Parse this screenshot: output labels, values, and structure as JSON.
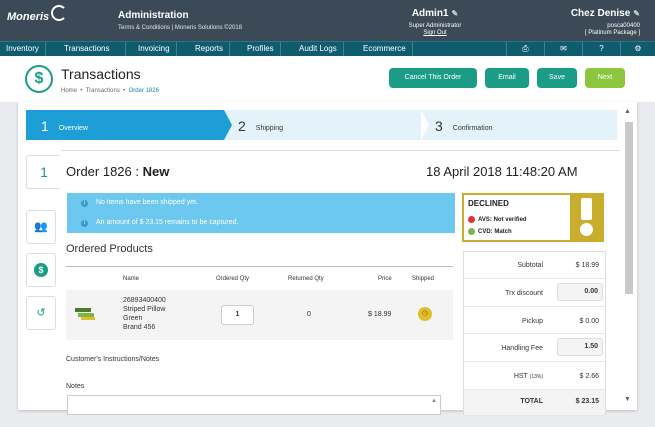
{
  "topbar": {
    "logo_text": "Moneris",
    "title": "Administration",
    "subtitle": "Terms & Conditions | Moneris Solutions ©2018",
    "user_name": "Admin1",
    "user_role": "Super Administrator",
    "sign_out": "Sign Out",
    "store_name": "Chez Denise",
    "store_id": "posca00400",
    "store_package": "[ Platinum Package ]"
  },
  "nav": {
    "items": [
      "Inventory",
      "Transactions",
      "Invoicing",
      "Reports",
      "Profiles",
      "Audit Logs",
      "Ecommerce"
    ],
    "icons": [
      "printer-icon",
      "mail-icon",
      "help-icon",
      "settings-icon"
    ]
  },
  "header": {
    "title": "Transactions",
    "breadcrumb": [
      "Home",
      "Transactions",
      "Order 1826"
    ],
    "buttons": {
      "cancel": "Cancel This Order",
      "email": "Email",
      "save": "Save",
      "next": "Next"
    }
  },
  "steps": [
    {
      "num": "1",
      "label": "Overview"
    },
    {
      "num": "2",
      "label": "Shipping"
    },
    {
      "num": "3",
      "label": "Confirmation"
    }
  ],
  "side_tabs": {
    "active_num": "1"
  },
  "order": {
    "title": "Order 1826",
    "separator": ":",
    "status": "New",
    "date": "18 April 2018 11:48:20 AM"
  },
  "info": {
    "line1": "No items have been shipped yet.",
    "line2": "An amount of $ 23.15 remains to be captured."
  },
  "declined": {
    "title": "DECLINED",
    "avs_label": "AVS:",
    "avs_value": "Not verified",
    "cvd_label": "CVD:",
    "cvd_value": "Match"
  },
  "products": {
    "title": "Ordered Products",
    "headers": {
      "name": "Name",
      "ordered": "Ordered Qty",
      "returned": "Returned Qty",
      "price": "Price",
      "shipped": "Shipped"
    },
    "rows": [
      {
        "sku": "26893400400",
        "name": "Striped Pillow",
        "color": "Green",
        "brand": "Brand 456",
        "ordered": "1",
        "returned": "0",
        "price": "$ 18.99"
      }
    ]
  },
  "instructions_label": "Customer's Instructions/Notes",
  "notes_label": "Notes",
  "summary": {
    "subtotal_label": "Subtotal",
    "subtotal": "$ 18.99",
    "discount_label": "Trx discount",
    "discount": "0.00",
    "pickup_label": "Pickup",
    "pickup": "$ 0.00",
    "handling_label": "Handling Fee",
    "handling": "1.50",
    "hst_label": "HST",
    "hst_rate": "(13%)",
    "hst": "$ 2.66",
    "total_label": "TOTAL",
    "total": "$ 23.15"
  },
  "colors": {
    "topbar": "#3b4a56",
    "nav": "#0f5c6e",
    "accent": "#1a9c86",
    "next": "#8cc63f",
    "step_active": "#1e9ed6",
    "info": "#6cc8ee",
    "declined": "#c9ad2c"
  }
}
